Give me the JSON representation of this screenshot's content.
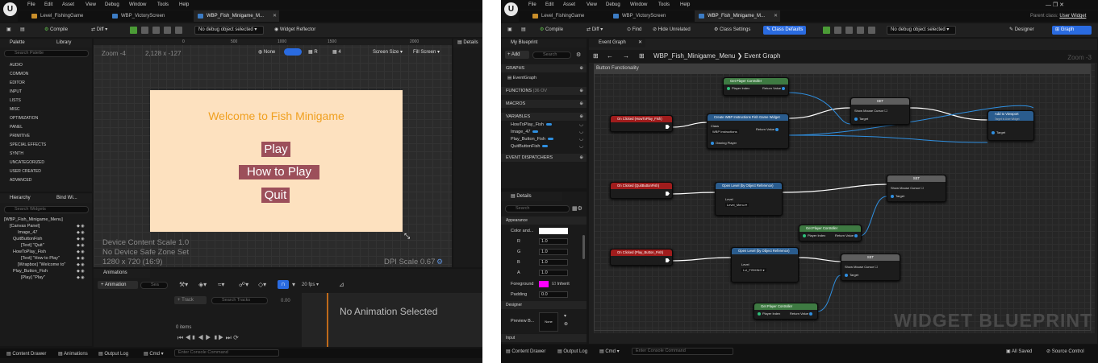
{
  "left": {
    "menu": [
      "File",
      "Edit",
      "Asset",
      "View",
      "Debug",
      "Window",
      "Tools",
      "Help"
    ],
    "tabs": [
      "Level_FishingGame",
      "WBP_VictoryScreen",
      "WBP_Fish_Minigame_M..."
    ],
    "toolbar": {
      "compile": "Compile",
      "diff": "Diff ▾",
      "debug": "No debug object selected ▾",
      "reflector": "Widget Reflector"
    },
    "palette": {
      "tab": "Palette",
      "library": "Library",
      "search": "Search Palette",
      "categories": [
        "AUDIO",
        "COMMON",
        "EDITOR",
        "INPUT",
        "LISTS",
        "MISC",
        "OPTIMIZATION",
        "PANEL",
        "PRIMITIVE",
        "SPECIAL EFFECTS",
        "SYNTH",
        "UNCATEGORIZED",
        "USER CREATED",
        "ADVANCED"
      ]
    },
    "hierarchy": {
      "tab": "Hierarchy",
      "bind": "Bind Wi...",
      "search": "Search Widgets",
      "items": [
        "[WBP_Fish_Minigame_Menu]",
        "[Canvas Panel]",
        "Image_47",
        "QuitButtonFish",
        "[Text] \"Quit\"",
        "HowToPlay_Fish",
        "[Text] \"How to Play\"",
        "[Wrapbox] \"Welcome to\"",
        "Play_Button_Fish",
        "[Play] \"Play\""
      ]
    },
    "ruler": [
      "0",
      "500",
      "1000",
      "1500",
      "2000"
    ],
    "viewport": {
      "zoom": "Zoom -4",
      "coords": "2,128 x -127",
      "none": "None",
      "r": "R",
      "four": "4",
      "screen_size": "Screen Size ▾",
      "fill_screen": "Fill Screen ▾",
      "device_scale": "Device Content Scale 1.0",
      "safe_zone": "No Device Safe Zone Set",
      "resolution": "1280 x 720 (16:9)",
      "dpi": "DPI Scale 0.67"
    },
    "canvas": {
      "title": "Welcome to Fish Minigame",
      "play": "Play",
      "how": "How to Play",
      "quit": "Quit"
    },
    "details_tab": "Details",
    "animations": {
      "tab": "Animations",
      "add": "+ Animation",
      "search": "Sea",
      "track": "+ Track",
      "search_tracks": "Search Tracks",
      "time": "0.00",
      "items": "0 items",
      "fps": "20 fps ▾",
      "none": "No Animation Selected"
    },
    "status": {
      "content": "Content Drawer",
      "anim": "Animations",
      "output": "Output Log",
      "cmd": "Cmd ▾",
      "console": "Enter Console Command"
    }
  },
  "right": {
    "menu": [
      "File",
      "Edit",
      "Asset",
      "View",
      "Debug",
      "Window",
      "Tools",
      "Help"
    ],
    "tabs": [
      "Level_FishingGame",
      "WBP_VictoryScreen",
      "WBP_Fish_Minigame_M..."
    ],
    "parent": "Parent class:",
    "parent_value": "User Widget",
    "toolbar": {
      "compile": "Compile",
      "diff": "Diff ▾",
      "find": "Find",
      "hide": "Hide Unrelated",
      "class_settings": "Class Settings",
      "class_defaults": "Class Defaults",
      "debug": "No debug object selected ▾",
      "designer": "Designer",
      "graph": "Graph"
    },
    "mybp": {
      "tab": "My Blueprint",
      "add": "+ Add",
      "search": "Search",
      "graphs": "GRAPHS",
      "event_graph": "EventGraph",
      "functions": "FUNCTIONS",
      "functions_count": "(36 OV",
      "macros": "MACROS",
      "variables": "VARIABLES",
      "vars": [
        "HowToPlay_Fish",
        "Image_47",
        "Play_Button_Fish",
        "QuitButtonFish"
      ],
      "dispatchers": "EVENT DISPATCHERS"
    },
    "details": {
      "tab": "Details",
      "search": "Search",
      "appearance": "Appearance",
      "color": "Color and...",
      "rows": [
        {
          "k": "R",
          "v": "1.0"
        },
        {
          "k": "G",
          "v": "1.0"
        },
        {
          "k": "B",
          "v": "1.0"
        },
        {
          "k": "A",
          "v": "1.0"
        }
      ],
      "foreground": "Foreground",
      "inherit": "Inherit",
      "padding": "Padding",
      "padding_v": "0.0",
      "designer": "Designer",
      "preview": "Preview B...",
      "preview_v": "None",
      "input": "Input"
    },
    "graph": {
      "tab": "Event Graph",
      "crumb_a": "WBP_Fish_Minigame_Menu",
      "crumb_sep": "❯",
      "crumb_b": "Event Graph",
      "zoom": "Zoom -3",
      "comment": "Button Functionality",
      "watermark": "WIDGET BLUEPRINT",
      "nodes": {
        "gpc1": "Get Player Controller",
        "gpc1_in": "Player Index",
        "gpc1_out": "Return Value",
        "click1": "On Clicked (HowToPlay_Fish)",
        "create": "Create WBP Instructions Fish Game Widget",
        "create_cls": "Class",
        "create_cls_v": "WBP Instructions",
        "create_ret": "Return Value",
        "create_own": "Owning Player",
        "set1": "SET",
        "set1_a": "Show Mouse Cursor",
        "set1_b": "Target",
        "addvp": "Add to Viewport",
        "addvp_sub": "Target is User Widget",
        "addvp_t": "Target",
        "click2": "On Clicked (QuitButtonFish)",
        "open1": "Open Level (by Object Reference)",
        "open1_lvl": "Level",
        "open1_v": "Level_Menu ▾",
        "set2": "SET",
        "set2_a": "Show Mouse Cursor",
        "set2_b": "Target",
        "gpc2": "Get Player Controller",
        "gpc2_in": "Player Index",
        "gpc2_out": "Return Value",
        "click3": "On Clicked (Play_Button_Fish)",
        "open2": "Open Level (by Object Reference)",
        "open2_lvl": "Level",
        "open2_v": "Lvl_FISHING ▾",
        "set3": "SET",
        "set3_a": "Show Mouse Cursor",
        "set3_b": "Target",
        "gpc3": "Get Player Controller",
        "gpc3_in": "Player Index",
        "gpc3_out": "Return Value"
      }
    },
    "status": {
      "content": "Content Drawer",
      "output": "Output Log",
      "cmd": "Cmd ▾",
      "console": "Enter Console Command",
      "saved": "All Saved",
      "source": "Source Control"
    }
  },
  "colors": {
    "accent": "#2a6be0",
    "canvas_bg": "#fde1bf",
    "title": "#f0a020",
    "button": "#9c4f5a",
    "event": "#a01c1c",
    "func": "#2a5c8e",
    "pure": "#3e7a42",
    "set": "#5e5e5e"
  }
}
